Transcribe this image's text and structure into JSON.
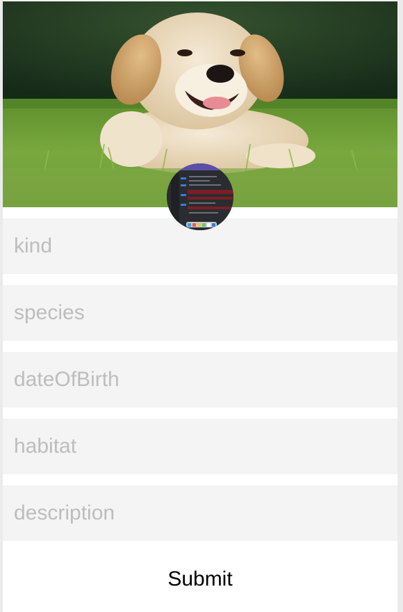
{
  "hero": {
    "subject": "puppy-in-grass"
  },
  "avatar": {
    "subject": "code-editor-screenshot"
  },
  "form": {
    "kind": {
      "value": "",
      "placeholder": "kind"
    },
    "species": {
      "value": "",
      "placeholder": "species"
    },
    "dateOfBirth": {
      "value": "",
      "placeholder": "dateOfBirth"
    },
    "habitat": {
      "value": "",
      "placeholder": "habitat"
    },
    "description": {
      "value": "",
      "placeholder": "description"
    },
    "submit_label": "Submit"
  },
  "colors": {
    "field_background": "#f4f4f4",
    "placeholder": "#bdbdbd",
    "page_background": "#ebebeb",
    "surface": "#ffffff"
  }
}
